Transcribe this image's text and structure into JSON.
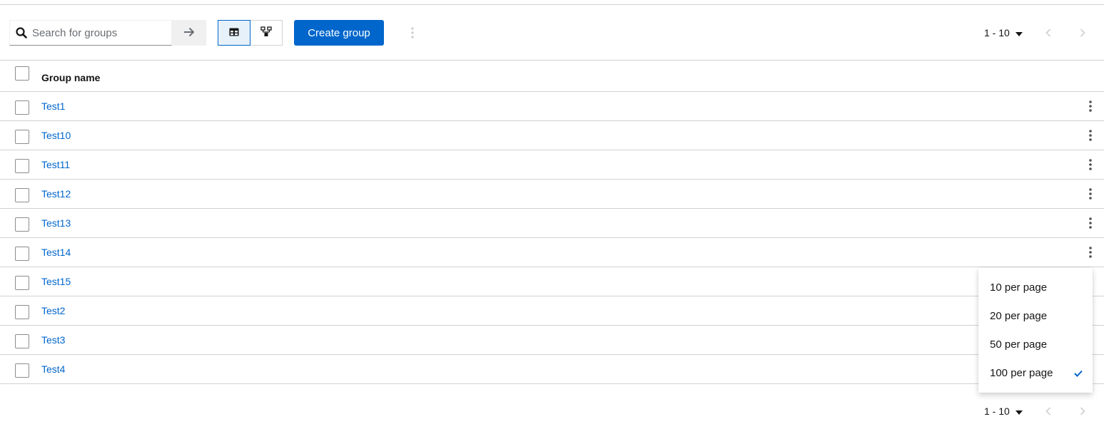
{
  "toolbar": {
    "search_placeholder": "Search for groups",
    "create_label": "Create group"
  },
  "pagination": {
    "range_label": "1 - 10"
  },
  "table": {
    "column_header": "Group name",
    "rows": [
      "Test1",
      "Test10",
      "Test11",
      "Test12",
      "Test13",
      "Test14",
      "Test15",
      "Test2",
      "Test3",
      "Test4"
    ]
  },
  "per_page_menu": {
    "items": [
      "10 per page",
      "20 per page",
      "50 per page",
      "100 per page"
    ],
    "selected_index": 3
  },
  "colors": {
    "accent": "#0066cc",
    "selected_toggle_bg": "#e7f1fa",
    "border": "#d2d2d2"
  },
  "icons": {
    "search": "search-icon",
    "submit": "arrow-right-icon",
    "table_view": "table-icon",
    "tree_view": "sitemap-icon",
    "kebab": "kebab-icon",
    "caret": "caret-down-icon",
    "prev": "angle-left-icon",
    "next": "angle-right-icon",
    "check": "check-icon"
  }
}
